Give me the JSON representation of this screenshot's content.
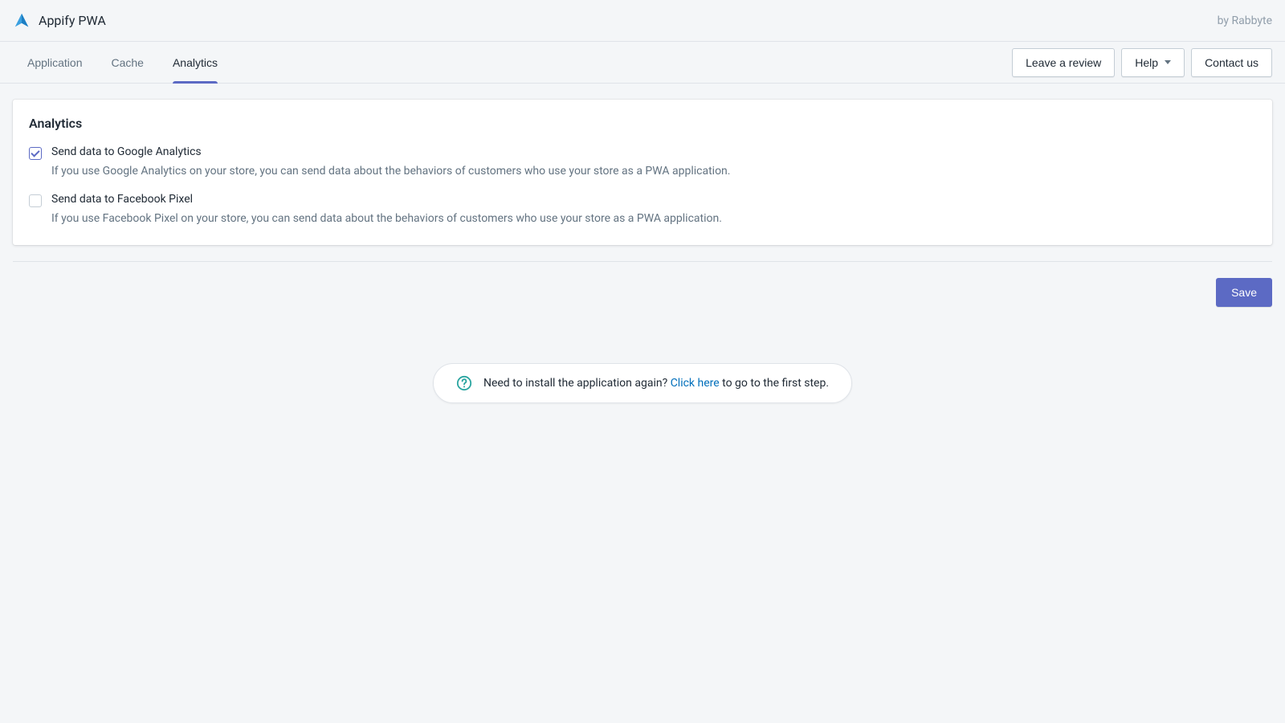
{
  "header": {
    "app_title": "Appify PWA",
    "byline": "by Rabbyte"
  },
  "nav": {
    "tabs": [
      {
        "label": "Application",
        "active": false
      },
      {
        "label": "Cache",
        "active": false
      },
      {
        "label": "Analytics",
        "active": true
      }
    ],
    "actions": {
      "leave_review": "Leave a review",
      "help": "Help",
      "contact_us": "Contact us"
    }
  },
  "main": {
    "card_title": "Analytics",
    "options": [
      {
        "checked": true,
        "label": "Send data to Google Analytics",
        "description": "If you use Google Analytics on your store, you can send data about the behaviors of customers who use your store as a PWA application."
      },
      {
        "checked": false,
        "label": "Send data to Facebook Pixel",
        "description": "If you use Facebook Pixel on your store, you can send data about the behaviors of customers who use your store as a PWA application."
      }
    ],
    "save_label": "Save"
  },
  "help_banner": {
    "pre_text": "Need to install the application again? ",
    "link_text": "Click here",
    "post_text": " to go to the first step."
  }
}
